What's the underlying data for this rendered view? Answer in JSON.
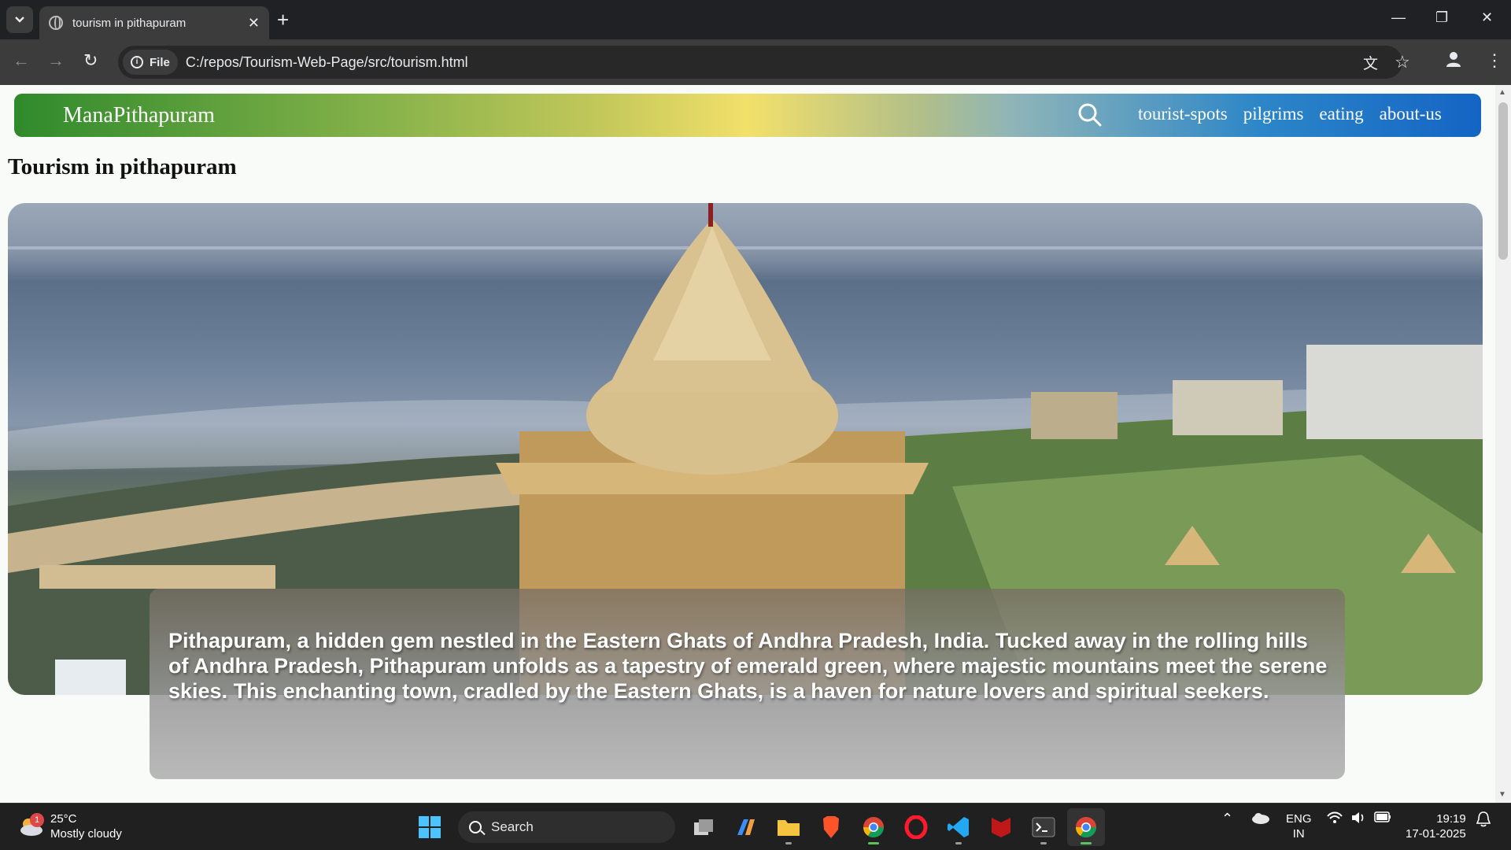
{
  "browser": {
    "tab_title": "tourism in pithapuram",
    "tab_close": "✕",
    "new_tab": "+",
    "site_chip": "File",
    "url": "C:/repos/Tourism-Web-Page/src/tourism.html",
    "window_controls": {
      "minimize": "—",
      "restore": "❐",
      "close": "✕"
    }
  },
  "page": {
    "brand": "ManaPithapuram",
    "nav_links": [
      "tourist-spots",
      "pilgrims",
      "eating",
      "about-us"
    ],
    "heading": "Tourism in pithapuram",
    "caption": "Pithapuram, a hidden gem nestled in the Eastern Ghats of Andhra Pradesh, India. Tucked away in the rolling hills of Andhra Pradesh, Pithapuram unfolds as a tapestry of emerald green, where majestic mountains meet the serene skies. This enchanting town, cradled by the Eastern Ghats, is a haven for nature lovers and spiritual seekers."
  },
  "taskbar": {
    "weather_badge": "1",
    "temperature": "25°C",
    "weather_desc": "Mostly cloudy",
    "search_label": "Search",
    "language": "ENG",
    "region": "IN",
    "time": "19:19",
    "date": "17-01-2025"
  },
  "colors": {
    "navbar_start": "#2f8a2c",
    "navbar_mid": "#f2e06a",
    "navbar_end": "#1464c4"
  }
}
